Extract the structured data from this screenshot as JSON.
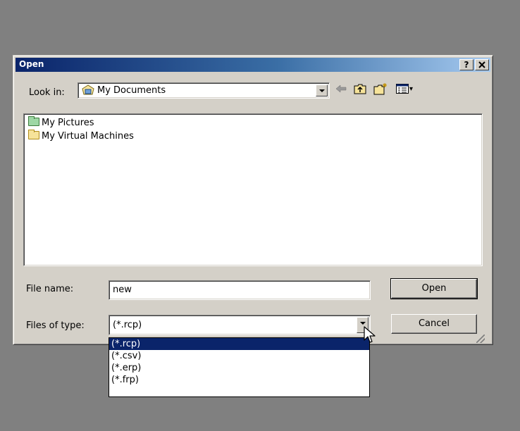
{
  "window": {
    "title": "Open",
    "help_label": "?",
    "close_label": "✕"
  },
  "look_in": {
    "label": "Look in:",
    "value": "My Documents"
  },
  "toolbar": {
    "back_glyph": "⇐",
    "views_glyph": "▾"
  },
  "files": [
    {
      "name": "My Pictures",
      "icon": "pictures-folder-icon"
    },
    {
      "name": "My Virtual Machines",
      "icon": "folder-icon"
    }
  ],
  "file_name": {
    "label": "File name:",
    "value": "new"
  },
  "file_type": {
    "label": "Files of type:",
    "value": "(*.rcp)",
    "options": [
      "(*.rcp)",
      "(*.csv)",
      "(*.erp)",
      "(*.frp)"
    ],
    "selected_index": 0
  },
  "buttons": {
    "open": "Open",
    "cancel": "Cancel"
  },
  "colors": {
    "titlebar_start": "#0a246a",
    "titlebar_end": "#a6caf0",
    "dialog_face": "#d4d0c8",
    "desktop": "#808080",
    "selection": "#0a246a"
  }
}
